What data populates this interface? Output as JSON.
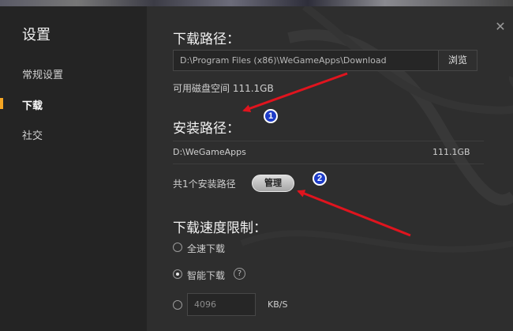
{
  "colors": {
    "sidebar_bg": "#242424",
    "main_bg": "#2e2e2e",
    "active_marker": "#f5a623",
    "annotation_arrow": "#e0141e",
    "annotation_badge": "#1e3cc8"
  },
  "sidebar": {
    "title": "设置",
    "items": [
      {
        "label": "常规设置",
        "active": false
      },
      {
        "label": "下载",
        "active": true
      },
      {
        "label": "社交",
        "active": false
      }
    ]
  },
  "window": {
    "close_icon": "close-icon"
  },
  "download": {
    "title": "下载路径：",
    "path_value": "D:\\Program Files (x86)\\WeGameApps\\Download",
    "browse_label": "浏览",
    "disk_space": "可用磁盘空间 111.1GB"
  },
  "install": {
    "title": "安装路径：",
    "path": "D:\\WeGameApps",
    "size": "111.1GB",
    "count_text": "共1个安装路径",
    "manage_label": "管理"
  },
  "speed": {
    "title": "下载速度限制：",
    "options": [
      {
        "label": "全速下载",
        "selected": false
      },
      {
        "label": "智能下载",
        "selected": true
      }
    ],
    "help_icon": "?",
    "limit_value": "4096",
    "unit": "KB/S"
  },
  "annotations": [
    {
      "number": "1"
    },
    {
      "number": "2"
    }
  ]
}
